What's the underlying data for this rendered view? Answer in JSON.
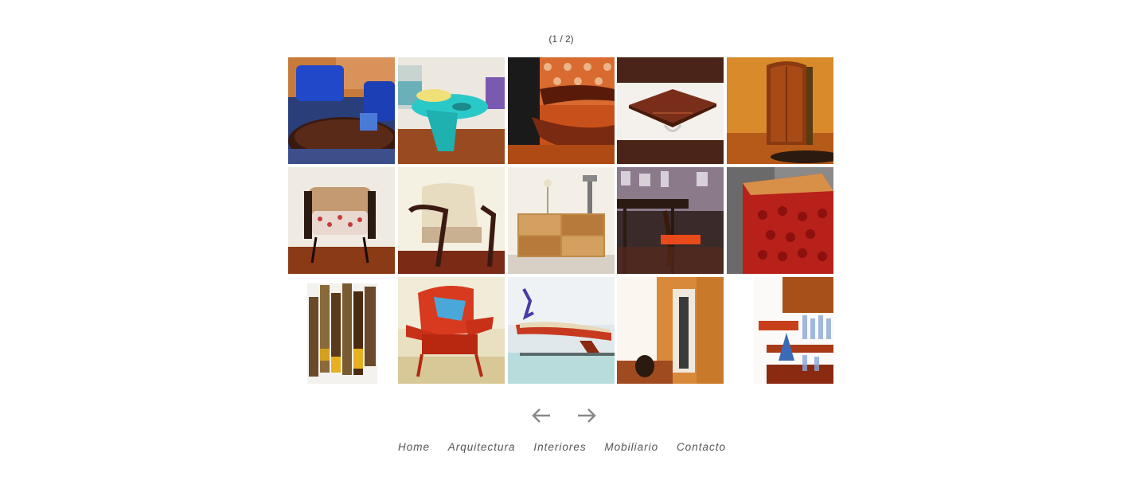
{
  "gallery": {
    "counter": "(1 / 2)",
    "thumbnails": [
      {
        "icon": "blue-armchairs-photo"
      },
      {
        "icon": "turquoise-table-photo"
      },
      {
        "icon": "wave-bench-photo"
      },
      {
        "icon": "wood-tray-photo"
      },
      {
        "icon": "wood-wardrobe-photo"
      },
      {
        "icon": "armchair-red-pattern-photo"
      },
      {
        "icon": "armchair-cream-photo"
      },
      {
        "icon": "burl-dresser-photo"
      },
      {
        "icon": "dining-chair-photo"
      },
      {
        "icon": "red-lace-cube-photo"
      },
      {
        "icon": "wood-sculpture-photo"
      },
      {
        "icon": "red-armchair-photo"
      },
      {
        "icon": "console-table-photo"
      },
      {
        "icon": "hallway-door-photo"
      },
      {
        "icon": "glass-shelf-photo"
      }
    ]
  },
  "pager": {
    "prev_icon": "arrow-left-icon",
    "next_icon": "arrow-right-icon"
  },
  "nav": {
    "items": [
      "Home",
      "Arquitectura",
      "Interiores",
      "Mobiliario",
      "Contacto"
    ]
  }
}
